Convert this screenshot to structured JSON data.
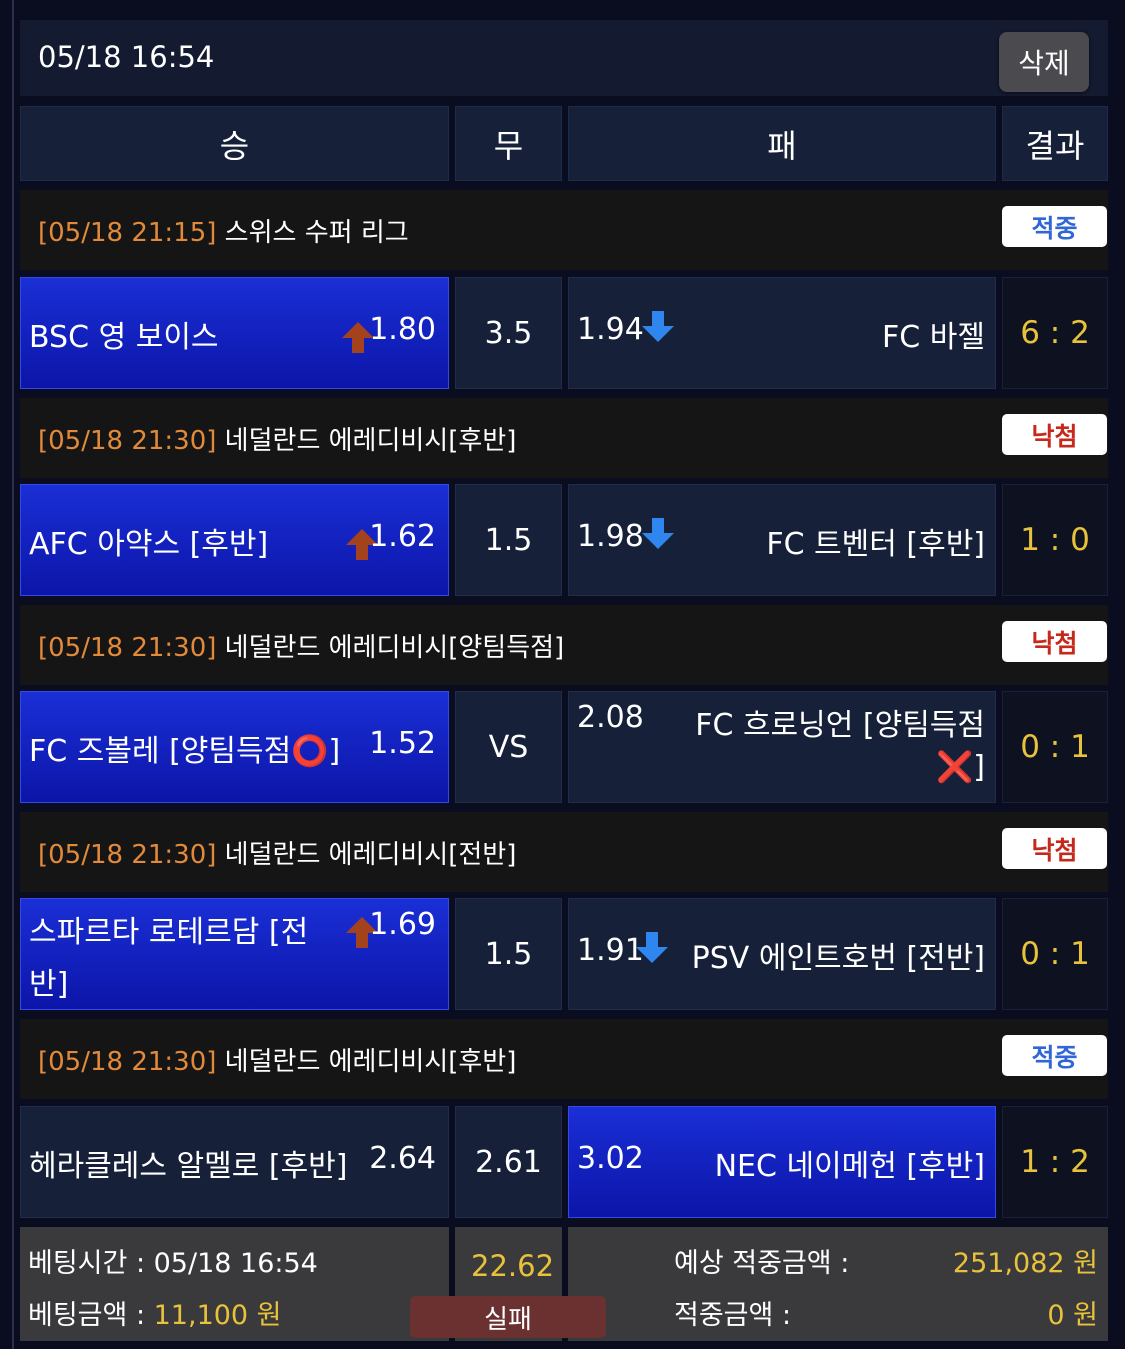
{
  "slip": {
    "datetime": "05/18 16:54",
    "delete_label": "삭제"
  },
  "headers": {
    "win": "승",
    "draw": "무",
    "lose": "패",
    "result": "결과"
  },
  "matches": [
    {
      "league_time": "[05/18 21:15]",
      "league_name": " 스위스 수퍼 리그",
      "status": "적중",
      "home": "BSC 영 보이스",
      "home_odds": "1.80",
      "draw": "3.5",
      "away_odds": "1.94",
      "away": "FC 바젤",
      "score": "6 : 2"
    },
    {
      "league_time": "[05/18 21:30]",
      "league_name": " 네덜란드 에레디비시[후반]",
      "status": "낙첨",
      "home": "AFC 아약스 [후반]",
      "home_odds": "1.62",
      "draw": "1.5",
      "away_odds": "1.98",
      "away": "FC 트벤터 [후반]",
      "score": "1 : 0"
    },
    {
      "league_time": "[05/18 21:30]",
      "league_name": " 네덜란드 에레디비시[양팀득점]",
      "status": "낙첨",
      "home": "FC 즈볼레 [양팀득점⭕]",
      "home_odds": "1.52",
      "draw": "VS",
      "away_odds": "2.08",
      "away_line1": "FC 흐로닝언 [양팀득점",
      "away_line2": "❌]",
      "score": "0 : 1"
    },
    {
      "league_time": "[05/18 21:30]",
      "league_name": " 네덜란드 에레디비시[전반]",
      "status": "낙첨",
      "home_line1": "스파르타 로테르담 [전",
      "home_line2": "반]",
      "home_odds": "1.69",
      "draw": "1.5",
      "away_odds": "1.91",
      "away": "PSV 에인트호번 [전반]",
      "score": "0 : 1"
    },
    {
      "league_time": "[05/18 21:30]",
      "league_name": " 네덜란드 에레디비시[후반]",
      "status": "적중",
      "home": "헤라클레스 알멜로 [후반]",
      "home_odds": "2.64",
      "draw": "2.61",
      "away_odds": "3.02",
      "away": "NEC 네이메헌 [후반]",
      "score": "1 : 2"
    }
  ],
  "footer": {
    "bet_time_label": "베팅시간 : ",
    "bet_time_value": "05/18 16:54",
    "bet_amount_label": "베팅금액 : ",
    "bet_amount_value": "11,100 원",
    "total_odds": "22.62",
    "result_label": "실패",
    "expected_label": "예상 적중금액 :",
    "expected_value": "251,082 원",
    "won_label": "적중금액 :",
    "won_value": "0 원"
  },
  "colors": {
    "selected": "#1a2fd6",
    "league_time": "#e38a3a",
    "score": "#e8c23a",
    "hit": "#2f67d6",
    "miss": "#c6281c",
    "odds_up": "#a4421e",
    "odds_down": "#2f86ee"
  },
  "icons": {
    "up": "arrow-up-icon",
    "down": "arrow-down-icon",
    "yes": "circle-o-icon",
    "no": "cross-x-icon"
  }
}
